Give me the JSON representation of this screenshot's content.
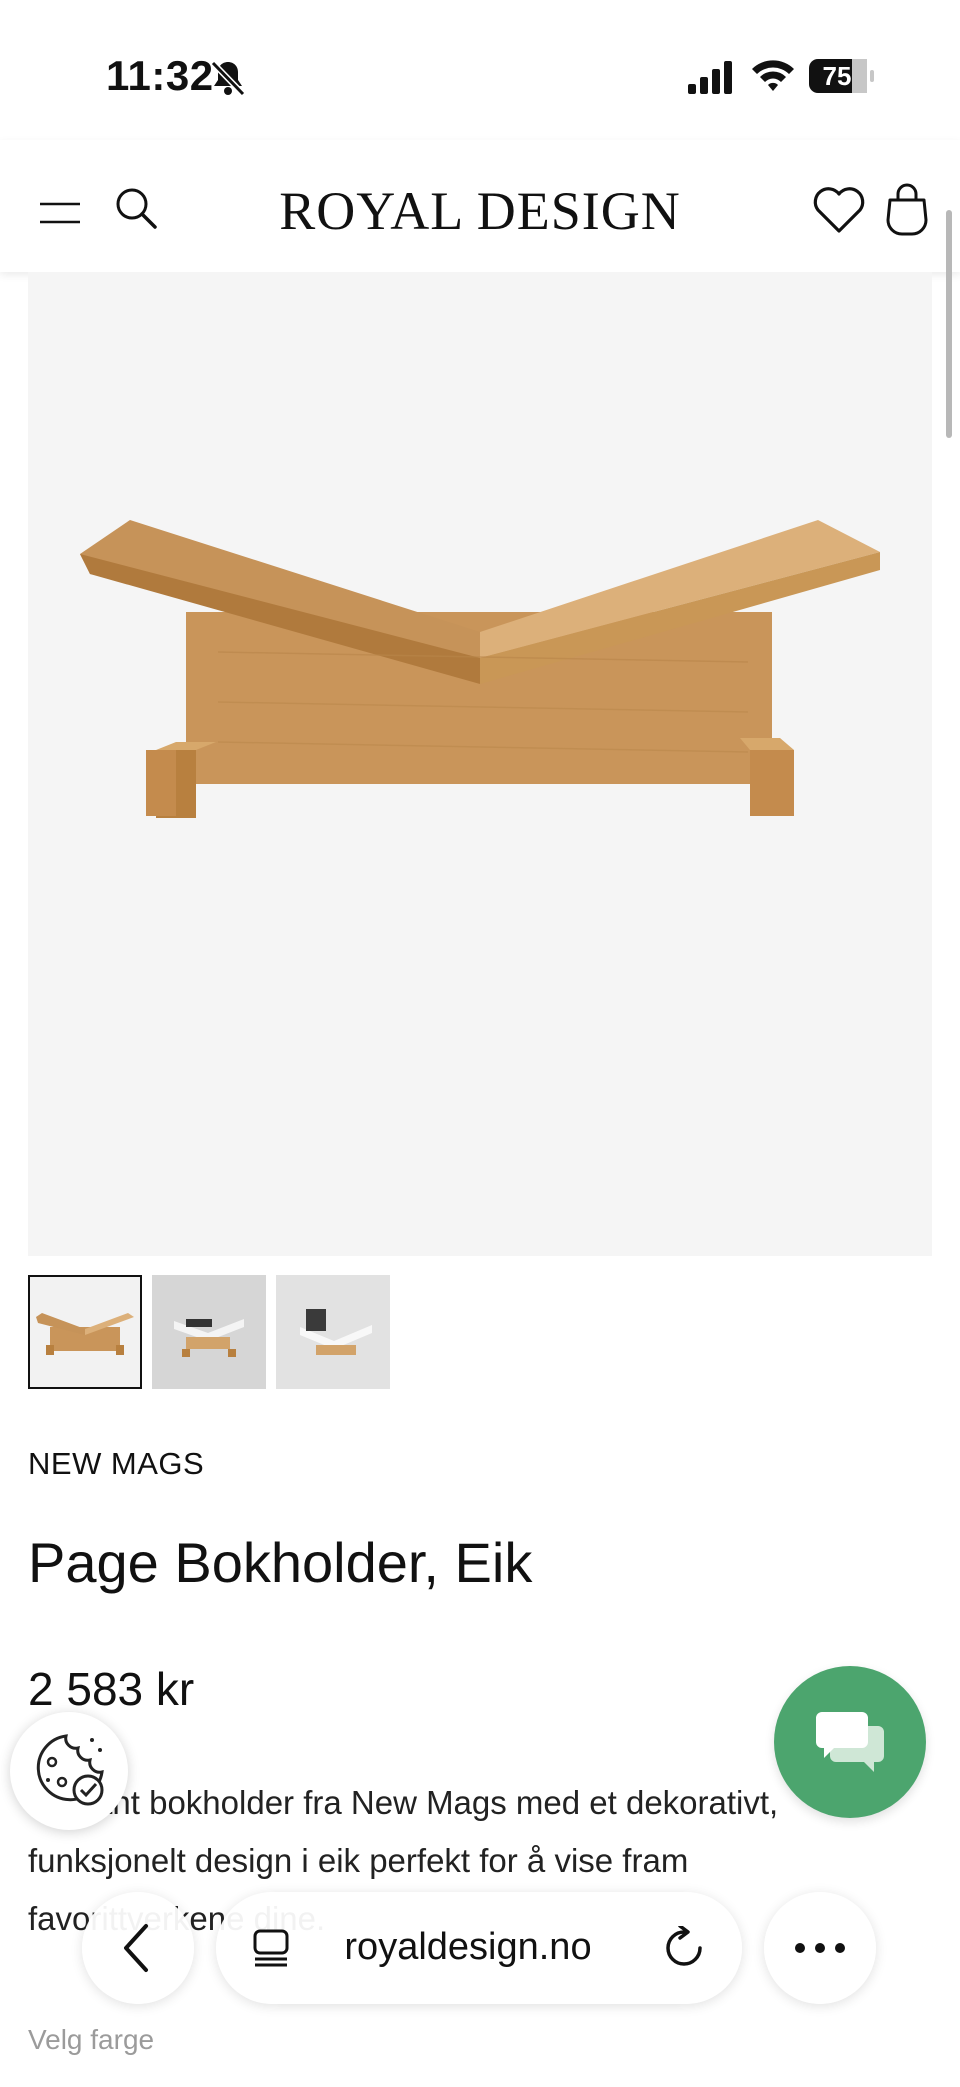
{
  "status_bar": {
    "time": "11:32",
    "battery": "75"
  },
  "header": {
    "brand": "ROYAL DESIGN"
  },
  "product": {
    "brand": "NEW MAGS",
    "title": "Page Bokholder, Eik",
    "price": "2 583 kr",
    "description": "Elegant bokholder fra New Mags med et dekorativt, funksjonelt design i eik perfekt for å vise fram favorittverkene dine.",
    "color_label": "Velg farge",
    "thumbnails": [
      "oak-bookholder-empty",
      "bookholder-with-book",
      "bookholder-with-magazine"
    ],
    "thumbnail_selected_index": 0
  },
  "browser": {
    "url": "royaldesign.no"
  },
  "colors": {
    "accent": "#4ca56e",
    "image_bg": "#f5f5f5",
    "muted_text": "#9b9b9b"
  },
  "icons": [
    "bell-slash-icon",
    "signal-icon",
    "wifi-icon",
    "battery-icon",
    "menu-icon",
    "search-icon",
    "heart-icon",
    "bag-icon",
    "chat-icon",
    "cookie-icon",
    "back-icon",
    "tabs-icon",
    "reload-icon",
    "more-icon"
  ]
}
